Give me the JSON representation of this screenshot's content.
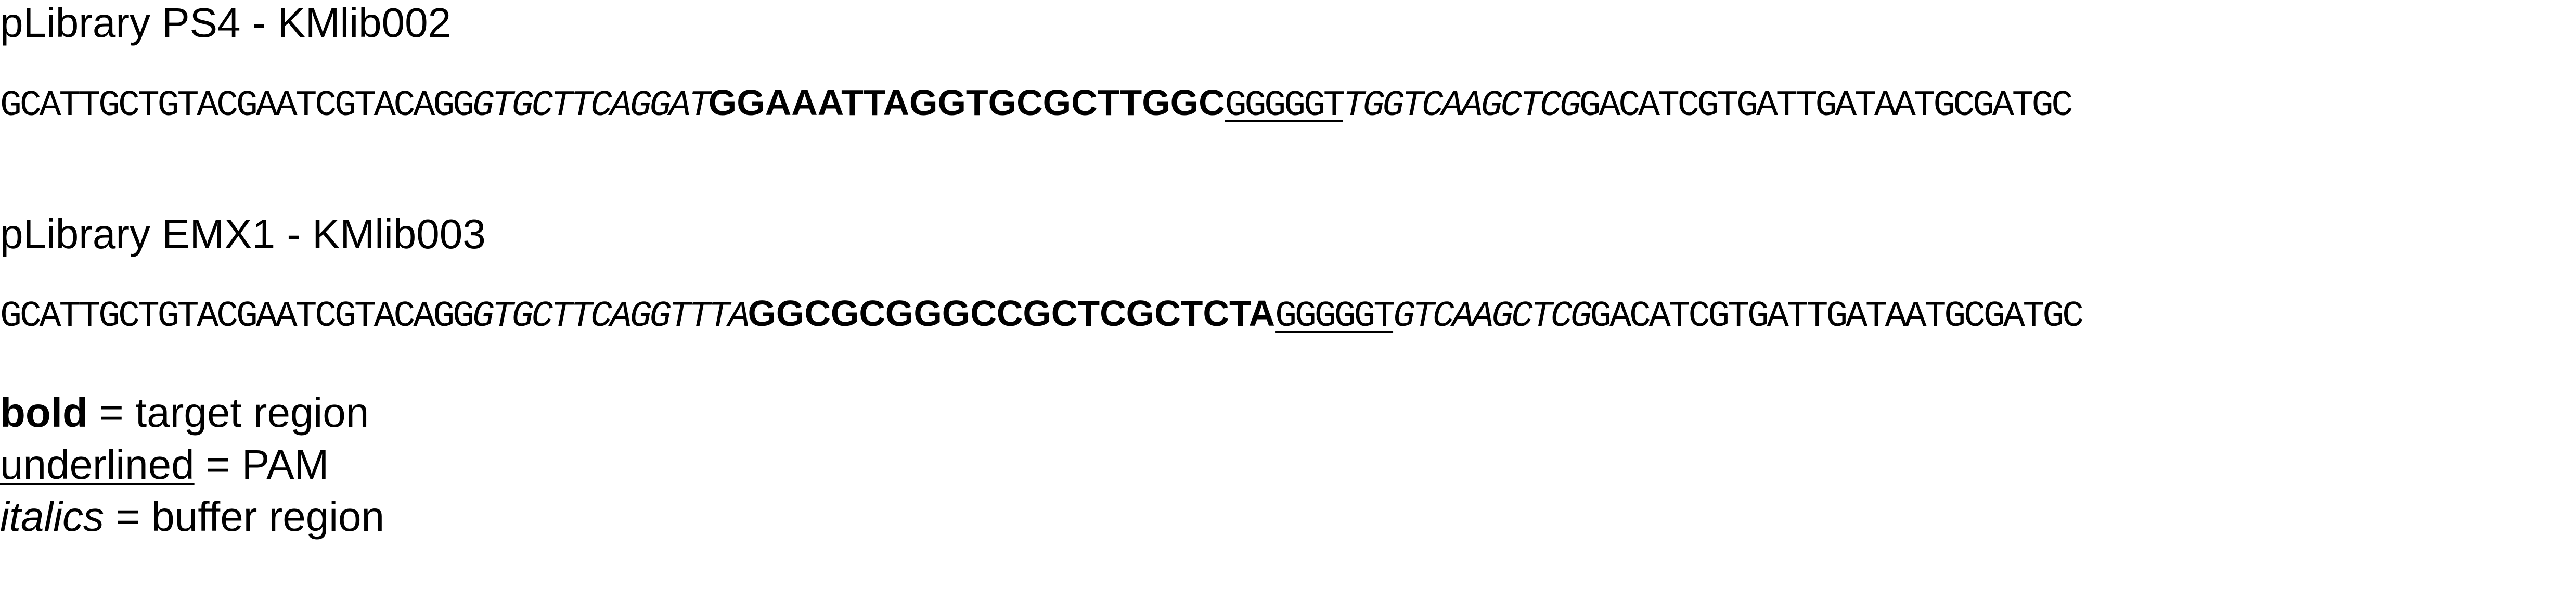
{
  "libraries": [
    {
      "title": "pLibrary PS4 - KMlib002",
      "seq_prefix": "GCATTGCTGTACGAATCGTACAGG",
      "buffer_1": "GTGCTTCAGGAT",
      "target": "GGAAATTAGGTGCGCTTGGC",
      "pam": "GGGGGT",
      "buffer_2": "TGGTCAAGCTCG",
      "seq_suffix": "GACATCGTGATTGATAATGCGATGC"
    },
    {
      "title": "pLibrary EMX1 - KMlib003",
      "seq_prefix": "GCATTGCTGTACGAATCGTACAGG",
      "buffer_1": "GTGCTTCAGGTTTA",
      "target": "GGCGCGGGCCGCTCGCTCTA",
      "pam": "GGGGGT",
      "buffer_2": "GTCAAGCTCG",
      "seq_suffix": "GACATCGTGATTGATAATGCGATGC"
    }
  ],
  "legend": {
    "bold": {
      "term": "bold",
      "desc": " = target region"
    },
    "underlined": {
      "term": "underlined",
      "desc": " = PAM"
    },
    "italics": {
      "term": "italics",
      "desc": " = buffer region"
    }
  }
}
